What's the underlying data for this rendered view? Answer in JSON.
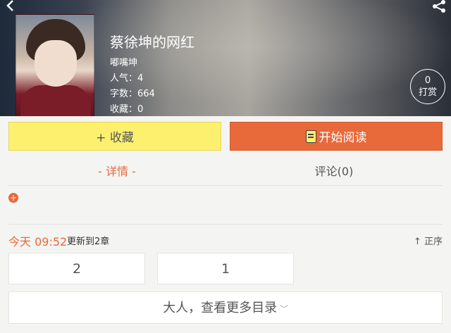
{
  "header": {
    "title": "蔡徐坤的网红",
    "author": "嘟嘴坤",
    "popularity": "人气：4",
    "word_count": "字数：664",
    "favorites": "收藏：0",
    "reward_count": "0",
    "reward_label": "打赏"
  },
  "actions": {
    "favorite_label": "+ 收藏",
    "read_label": "开始阅读"
  },
  "tabs": [
    {
      "label": "- 详情 -",
      "active": true
    },
    {
      "label": "评论(0)",
      "active": false
    }
  ],
  "update": {
    "time": "今天 09:52",
    "text": "更新到2章",
    "sort_label": "↑ 正序"
  },
  "chapters": [
    "2",
    "1"
  ],
  "more_toc_label": "大人，查看更多目录",
  "colors": {
    "accent": "#e8693a",
    "favorite_bg": "#fdf06f"
  }
}
